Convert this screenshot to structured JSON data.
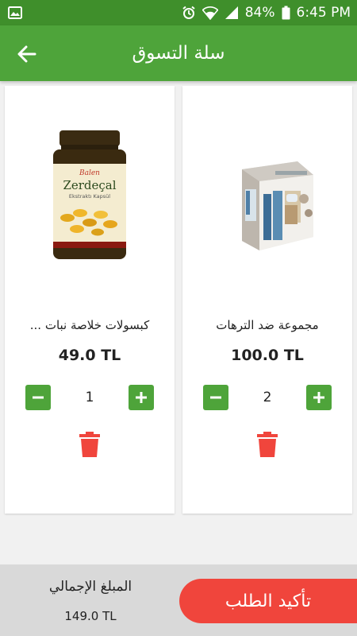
{
  "status_bar": {
    "battery": "84%",
    "time": "6:45 PM"
  },
  "header": {
    "title": "سلة التسوق"
  },
  "cart": {
    "items": [
      {
        "name": "مجموعة ضد الترهات",
        "price": "100.0 TL",
        "quantity": "2"
      },
      {
        "name": "كبسولات خلاصة نبات ...",
        "price": "49.0 TL",
        "quantity": "1"
      }
    ]
  },
  "footer": {
    "total_label": "المبلغ الإجمالي",
    "total_value": "149.0 TL",
    "confirm_label": "تأكيد الطلب"
  },
  "colors": {
    "status_bar": "#3f8f2b",
    "app_bar": "#4ea43a",
    "accent_green": "#4ea43a",
    "delete_red": "#f0453c",
    "confirm_red": "#f0453c",
    "footer_bg": "#d9d9d9"
  },
  "icons": {
    "back": "arrow-back-icon",
    "minus": "minus-icon",
    "plus": "plus-icon",
    "delete": "trash-icon",
    "gallery": "image-icon",
    "alarm": "alarm-icon",
    "wifi": "wifi-icon",
    "signal": "signal-icon",
    "battery": "battery-icon"
  },
  "product_image_text": {
    "brand": "Balen",
    "name": "Zerdeçal",
    "subtitle": "Ekstraktı Kapsül"
  }
}
